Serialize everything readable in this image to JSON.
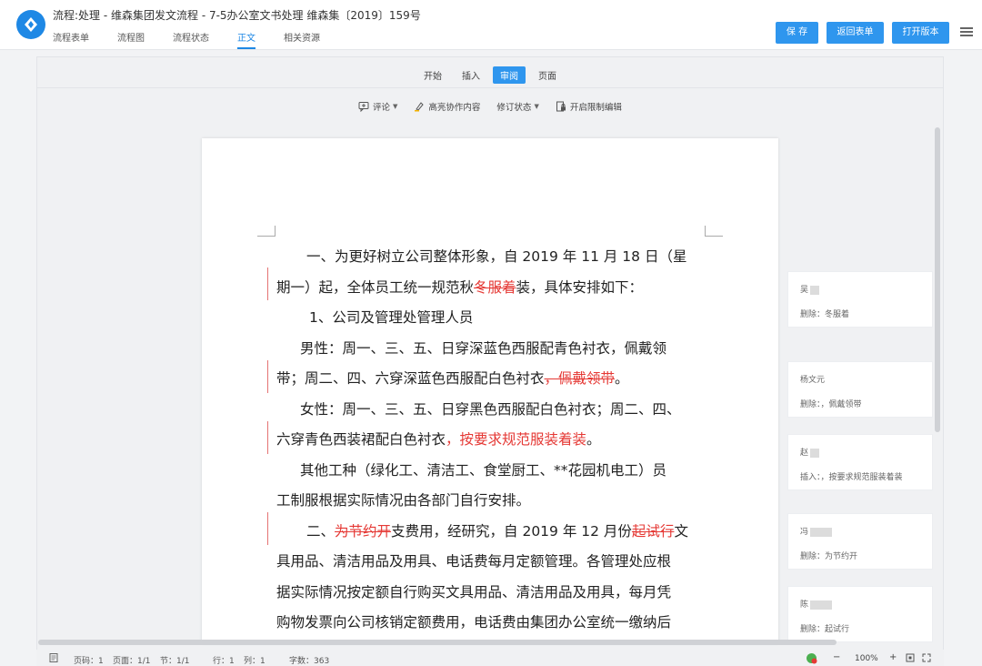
{
  "header": {
    "title": "流程:处理 - 维森集团发文流程 - 7-5办公室文书处理 维森集〔2019〕159号",
    "tabs": [
      "流程表单",
      "流程图",
      "流程状态",
      "正文",
      "相关资源"
    ],
    "active_tab": "正文",
    "buttons": {
      "save": "保 存",
      "back": "返回表单",
      "open": "打开版本"
    },
    "accent": "#2f96ee"
  },
  "ribbon": {
    "tabs": [
      "开始",
      "插入",
      "审阅",
      "页面"
    ],
    "active_tab": "审阅",
    "tools": {
      "comment": "评论",
      "highlight": "高亮协作内容",
      "revision": "修订状态",
      "restrict": "开启限制编辑"
    }
  },
  "document": {
    "lines": [
      {
        "parts": [
          {
            "t": "一、为更好树立公司整体形象，自 2019 年 11 月 18 日（星"
          }
        ]
      },
      {
        "parts": [
          {
            "t": "期一）起，全体员工统一规范秋"
          },
          {
            "t": "冬服着",
            "del": true
          },
          {
            "t": "装，具体安排如下："
          }
        ]
      },
      {
        "parts": [
          {
            "t": "1、公司及管理处管理人员"
          }
        ]
      },
      {
        "parts": [
          {
            "t": "男性：周一、三、五、日穿深蓝色西服配青色衬衣，佩戴领"
          }
        ]
      },
      {
        "parts": [
          {
            "t": "带；周二、四、六穿深蓝色西服配白色衬衣"
          },
          {
            "t": "，佩戴领带",
            "del": true
          },
          {
            "t": "。"
          }
        ]
      },
      {
        "parts": [
          {
            "t": "女性：周一、三、五、日穿黑色西服配白色衬衣；周二、四、"
          }
        ]
      },
      {
        "parts": [
          {
            "t": "六穿青色西装裙配白色衬衣"
          },
          {
            "t": "，按要求规范服装着装",
            "ins": true
          },
          {
            "t": "。"
          }
        ]
      },
      {
        "parts": [
          {
            "t": "其他工种（绿化工、清洁工、食堂厨工、**花园机电工）员"
          }
        ]
      },
      {
        "parts": [
          {
            "t": "工制服根据实际情况由各部门自行安排。"
          }
        ]
      },
      {
        "parts": [
          {
            "t": "二、"
          },
          {
            "t": "为节约开",
            "del": true
          },
          {
            "t": "支费用，经研究，自 2019 年 12 月份"
          },
          {
            "t": "起试行",
            "del": true
          },
          {
            "t": "文"
          }
        ]
      },
      {
        "parts": [
          {
            "t": "具用品、清洁用品及用具、电话费每月定额管理。各管理处应根"
          }
        ]
      },
      {
        "parts": [
          {
            "t": "据实际情况按定额自行购买文具用品、清洁用品及用具，每月凭"
          }
        ]
      },
      {
        "parts": [
          {
            "t": "购物发票向公司核销定额费用，电话费由集团办公室统一缴纳后"
          }
        ]
      }
    ]
  },
  "comments": [
    {
      "author": "吴",
      "text": "删除：冬服着"
    },
    {
      "author": "杨文元",
      "text": "删除：，佩戴领带"
    },
    {
      "author": "赵",
      "text": "插入：，按要求规范服装着装"
    },
    {
      "author": "冯",
      "text": "删除：为节约开"
    },
    {
      "author": "陈",
      "text": "删除：起试行"
    }
  ],
  "status": {
    "page_code": "页码：1",
    "pages": "页面：1/1",
    "section": "节：1/1",
    "row": "行：1",
    "col": "列：1",
    "word_count": "字数：363",
    "zoom": "100%"
  },
  "colors": {
    "revision": "#e53935",
    "accent": "#2f96ee"
  }
}
